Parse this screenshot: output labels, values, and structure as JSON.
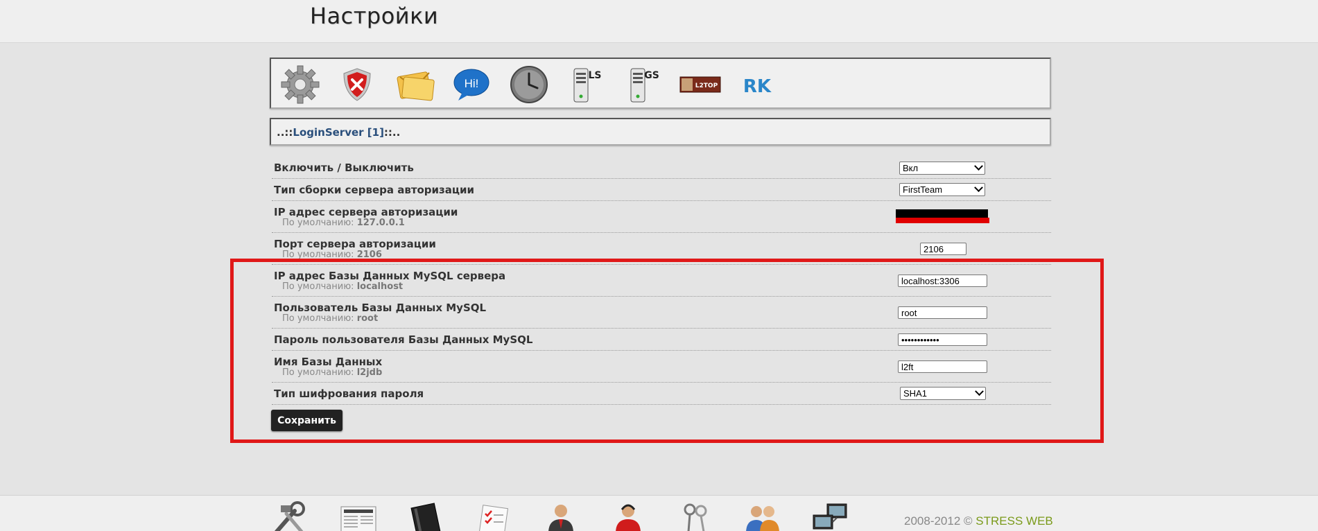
{
  "header": {
    "title": "Настройки"
  },
  "toolbar": {
    "icons": [
      {
        "name": "gear-icon"
      },
      {
        "name": "shield-icon"
      },
      {
        "name": "mail-icon"
      },
      {
        "name": "chat-bubble-icon",
        "text": "Hi!"
      },
      {
        "name": "clock-icon"
      },
      {
        "name": "login-server-icon",
        "text": "LS"
      },
      {
        "name": "game-server-icon",
        "text": "GS"
      },
      {
        "name": "l2top-icon",
        "text": "L2TOP"
      },
      {
        "name": "rk-icon",
        "text": "RK"
      }
    ]
  },
  "breadcrumb": {
    "prefix": "..::",
    "name": "LoginServer [1]",
    "suffix": "::.."
  },
  "form": {
    "enable": {
      "label": "Включить / Выключить",
      "value": "Вкл"
    },
    "server_type": {
      "label": "Тип сборки сервера авторизации",
      "value": "FirstTeam"
    },
    "ip": {
      "label": "IP адрес сервера авторизации",
      "default_label": "По умолчанию:",
      "default": "127.0.0.1"
    },
    "port": {
      "label": "Порт сервера авторизации",
      "default_label": "По умолчанию:",
      "default": "2106",
      "value": "2106"
    },
    "db_host": {
      "label": "IP адрес Базы Данных MySQL сервера",
      "default_label": "По умолчанию:",
      "default": "localhost",
      "value": "localhost:3306"
    },
    "db_user": {
      "label": "Пользователь Базы Данных MySQL",
      "default_label": "По умолчанию:",
      "default": "root",
      "value": "root"
    },
    "db_pass": {
      "label": "Пароль пользователя Базы Данных MySQL",
      "value": "••••••••••••"
    },
    "db_name": {
      "label": "Имя Базы Данных",
      "default_label": "По умолчанию:",
      "default": "l2jdb",
      "value": "l2ft"
    },
    "hash": {
      "label": "Тип шифрования пароля",
      "value": "SHA1"
    },
    "save_label": "Сохранить"
  },
  "footer": {
    "icons": [
      "tools-icon",
      "newspaper-icon",
      "book-icon",
      "checklist-icon",
      "user-icon",
      "support-agent-icon",
      "keys-icon",
      "users-icon",
      "network-icon"
    ],
    "copyright_prefix": "2008-2012 © ",
    "brand": "STRESS WEB"
  },
  "colors": {
    "highlight": "#e01818",
    "brand": "#7a9a1a",
    "link": "#2a4f7c"
  }
}
